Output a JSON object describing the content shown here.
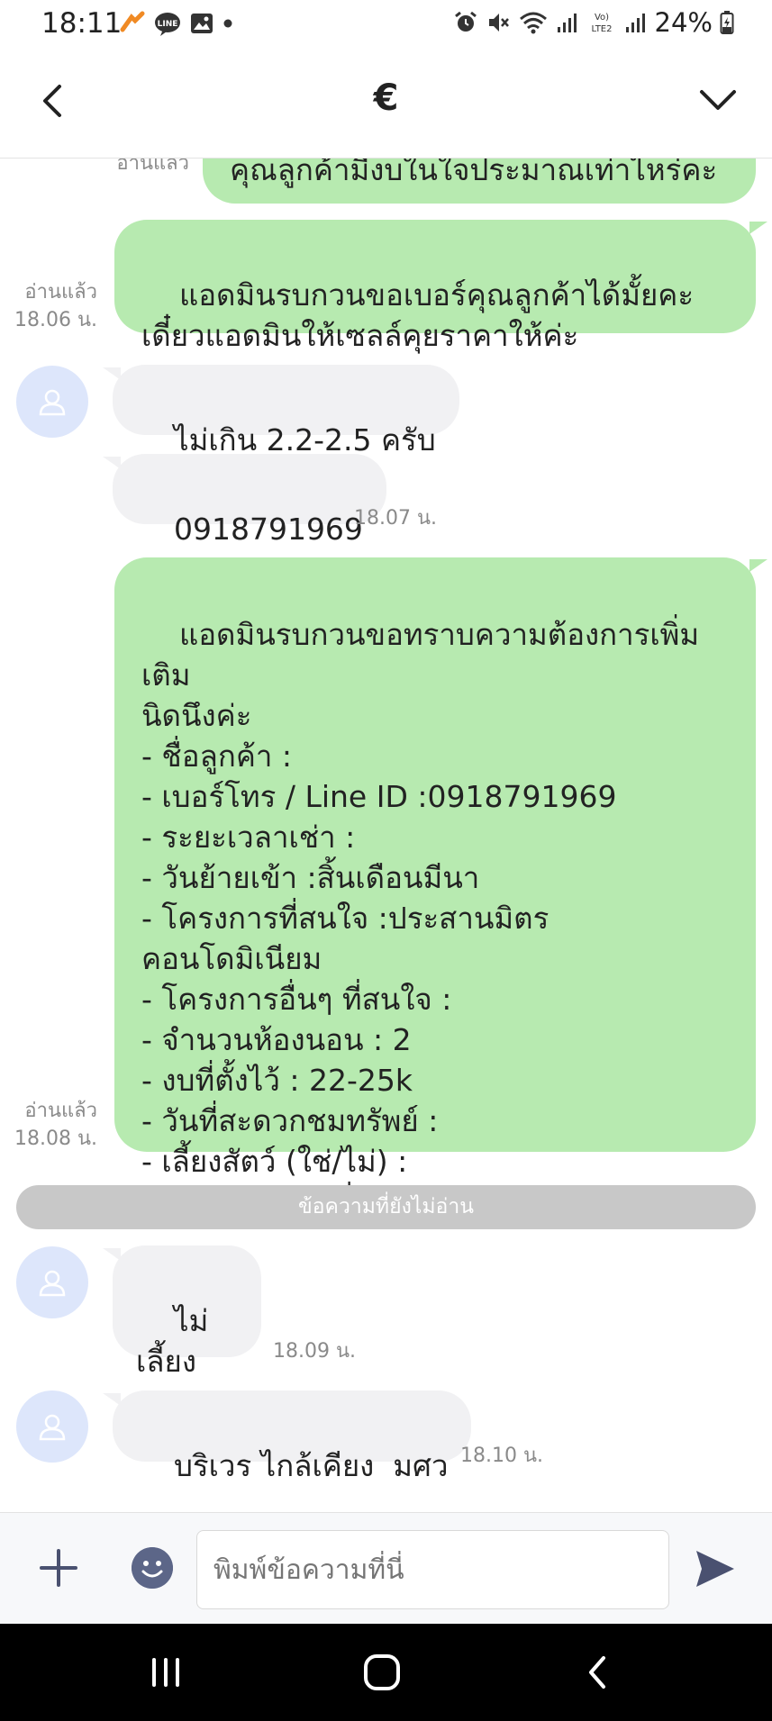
{
  "status_bar": {
    "time": "18:11",
    "battery": "24%",
    "network_label": "Vo) LTE2"
  },
  "header": {
    "title": "€"
  },
  "messages": {
    "m0": {
      "text": "คุณลูกค้ามีงบในใจประมาณเท่าไหร่คะ",
      "read": "อ่านแล้ว"
    },
    "m1": {
      "text": "แอดมินรบกวนขอเบอร์คุณลูกค้าได้มั้ยคะ\nเดี๋ยวแอดมินให้เซลล์คุยราคาให้ค่ะ",
      "read": "อ่านแล้ว",
      "time": "18.06 น."
    },
    "m2": {
      "text": "ไม่เกิน 2.2-2.5 ครับ"
    },
    "m3": {
      "text": "0918791969",
      "time": "18.07 น."
    },
    "m4": {
      "text": "แอดมินรบกวนขอทราบความต้องการเพิ่มเติม\nนิดนึงค่ะ\n- ชื่อลูกค้า :\n- เบอร์โทร / Line ID :0918791969\n- ระยะเวลาเช่า :\n- วันย้ายเข้า :สิ้นเดือนมีนา\n- โครงการที่สนใจ :ประสานมิตร\nคอนโดมิเนียม\n- โครงการอื่นๆ ที่สนใจ :\n- จำนวนห้องนอน : 2\n- งบที่ตั้งไว้ : 22-25k\n- วันที่สะดวกชมทรัพย์ :\n- เลี้ยงสัตว์ (ใช่/ไม่) :\n- ความต้องการอื่นๆ (ถ้ามี) :",
      "read": "อ่านแล้ว",
      "time": "18.08 น."
    },
    "unread_divider": "ข้อความที่ยังไม่อ่าน",
    "m5": {
      "text": "ไม่เลี้ยง",
      "time": "18.09 น."
    },
    "m6": {
      "text": "บริเวร ไกล้เคียง  มศว",
      "time": "18.10 น."
    }
  },
  "input_bar": {
    "placeholder": "พิมพ์ข้อความที่นี่"
  },
  "icons": {
    "back": "chevron-left-icon",
    "menu": "chevron-down-icon",
    "plus": "plus-icon",
    "emoji": "emoji-icon",
    "send": "send-icon",
    "avatar": "person-icon"
  },
  "colors": {
    "my_bubble": "#b7eab0",
    "their_bubble": "#f1f1f3",
    "avatar_bg": "#dde6fb",
    "divider": "#c8c8c8"
  }
}
